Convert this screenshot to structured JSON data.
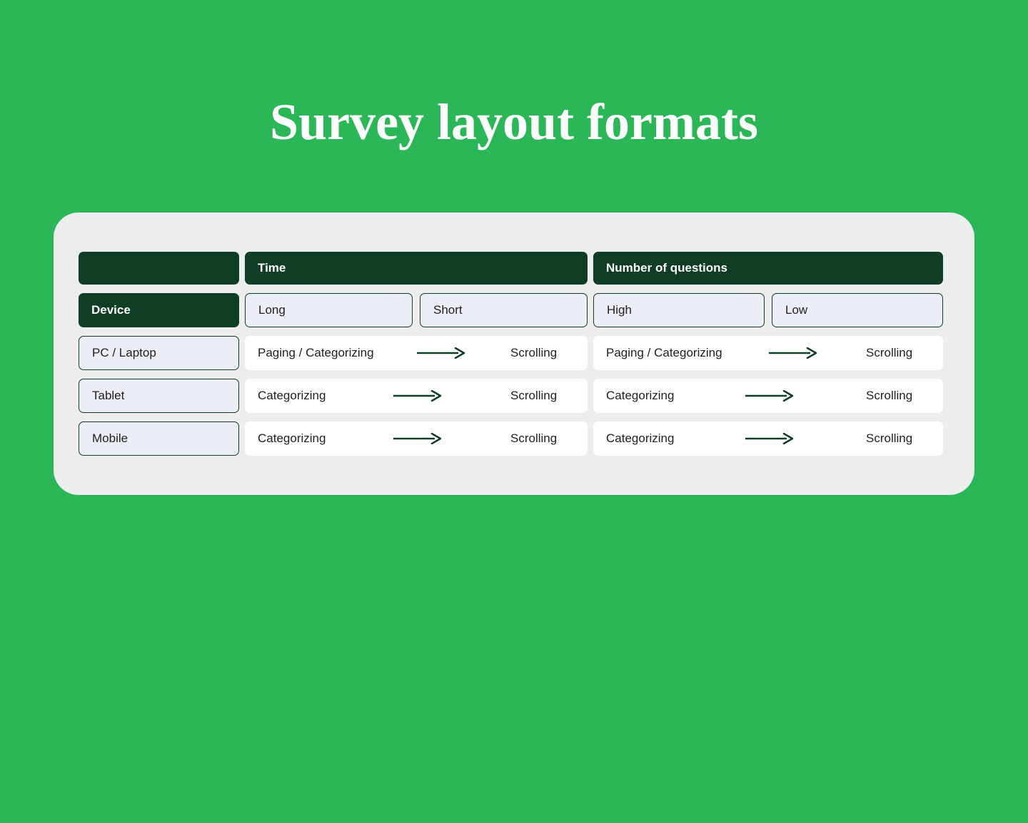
{
  "chart_data": {
    "type": "table",
    "title": "Survey layout formats",
    "row_dimension": "Device",
    "column_groups": [
      {
        "name": "Time",
        "subcolumns": [
          "Long",
          "Short"
        ]
      },
      {
        "name": "Number of questions",
        "subcolumns": [
          "High",
          "Low"
        ]
      }
    ],
    "rows": [
      {
        "device": "PC / Laptop",
        "time": {
          "from": "Paging / Categorizing",
          "to": "Scrolling"
        },
        "questions": {
          "from": "Paging / Categorizing",
          "to": "Scrolling"
        }
      },
      {
        "device": "Tablet",
        "time": {
          "from": "Categorizing",
          "to": "Scrolling"
        },
        "questions": {
          "from": "Categorizing",
          "to": "Scrolling"
        }
      },
      {
        "device": "Mobile",
        "time": {
          "from": "Categorizing",
          "to": "Scrolling"
        },
        "questions": {
          "from": "Categorizing",
          "to": "Scrolling"
        }
      }
    ]
  },
  "title": "Survey layout formats",
  "headers": {
    "device": "Device",
    "time": "Time",
    "questions": "Number of questions"
  },
  "subheaders": {
    "time_long": "Long",
    "time_short": "Short",
    "q_high": "High",
    "q_low": "Low"
  },
  "rows": [
    {
      "device": "PC / Laptop",
      "time_from": "Paging / Categorizing",
      "time_to": "Scrolling",
      "q_from": "Paging / Categorizing",
      "q_to": "Scrolling"
    },
    {
      "device": "Tablet",
      "time_from": "Categorizing",
      "time_to": "Scrolling",
      "q_from": "Categorizing",
      "q_to": "Scrolling"
    },
    {
      "device": "Mobile",
      "time_from": "Categorizing",
      "time_to": "Scrolling",
      "q_from": "Categorizing",
      "q_to": "Scrolling"
    }
  ]
}
